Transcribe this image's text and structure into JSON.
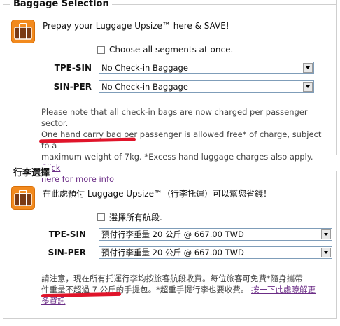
{
  "en": {
    "title": "Baggage Selection",
    "promo": "Prepay your Luggage Upsize™ here & SAVE!",
    "choose_all": "Choose all segments at once.",
    "segments": [
      {
        "route": "TPE-SIN",
        "selected": "No Check-in Baggage"
      },
      {
        "route": "SIN-PER",
        "selected": "No Check-in Baggage"
      }
    ],
    "note_lines": [
      "Please note that all check-in bags are now charged per passenger sector.",
      "One hand carry bag per passenger is allowed free* of charge, subject to a"
    ],
    "note_line3_text": "maximum weight of 7kg. *Excess hand luggage charges also apply.",
    "link_part1": "Click",
    "link_part2": "here for more info"
  },
  "zh": {
    "title": "行李選擇",
    "promo": "在此處預付 Luggage Upsize™（行李托運）可以幫您省錢！",
    "choose_all": "選擇所有航段.",
    "segments": [
      {
        "route": "TPE-SIN",
        "selected": "預付行李重量 20 公斤 @ 667.00  TWD"
      },
      {
        "route": "SIN-PER",
        "selected": "預付行李重量 20 公斤 @ 667.00  TWD"
      }
    ],
    "note_line1": "請注意，現在所有托運行李均按旅客航段收費。每位旅客可免費*隨身攜帶一",
    "note_line2_text": "件重量不超過 7 公斤的手提包。*超重手提行李也要收費。",
    "link_part1": "按一下此處瞭解更",
    "link_part2": "多資訊"
  },
  "colors": {
    "icon_orange": "#f28a1e",
    "highlight_red": "#e0142a",
    "link_purple": "#6b2d86"
  }
}
